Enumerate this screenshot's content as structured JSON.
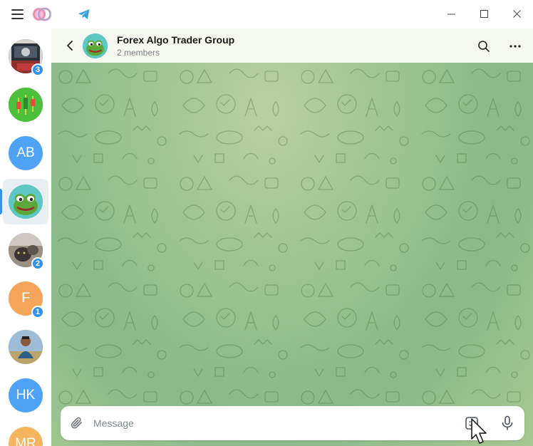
{
  "titlebar": {
    "icons": [
      "hamburger-menu-icon",
      "app-logo-icon",
      "telegram-icon",
      "minimize-icon",
      "maximize-icon",
      "close-icon"
    ]
  },
  "sidebar": {
    "chats": [
      {
        "kind": "photo",
        "badge": "3",
        "active": false
      },
      {
        "kind": "candlestick-chart",
        "badge": "",
        "active": false
      },
      {
        "kind": "initials",
        "initials": "AB",
        "color": "#4fa3f7",
        "badge": "",
        "active": false
      },
      {
        "kind": "pepe-frog",
        "badge": "",
        "active": true
      },
      {
        "kind": "photo",
        "badge": "2",
        "active": false
      },
      {
        "kind": "initials",
        "initials": "F",
        "color": "#f5a55a",
        "badge": "1",
        "active": false
      },
      {
        "kind": "photo",
        "badge": "",
        "active": false
      },
      {
        "kind": "initials",
        "initials": "HK",
        "color": "#4fa3f7",
        "badge": "",
        "active": false
      },
      {
        "kind": "initials",
        "initials": "MR",
        "color": "#f5b55f",
        "badge": "",
        "active": false
      }
    ]
  },
  "header": {
    "title": "Forex Algo Trader Group",
    "subtitle": "2 members"
  },
  "composer": {
    "placeholder": "Message"
  },
  "colors": {
    "accent": "#3390ec",
    "header_bg": "#f5f8ef",
    "wallpaper": "#9cc391"
  }
}
